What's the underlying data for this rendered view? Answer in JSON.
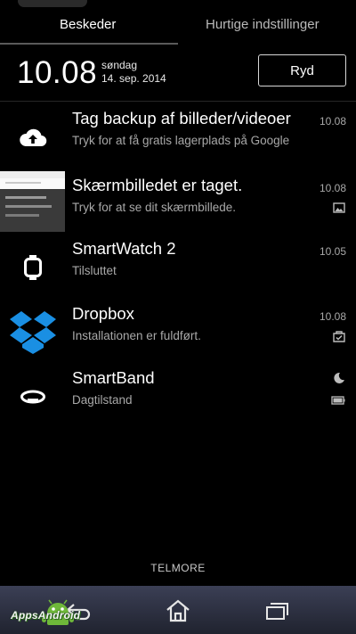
{
  "tabs": {
    "messages": "Beskeder",
    "quick_settings": "Hurtige indstillinger"
  },
  "header": {
    "time": "10.08",
    "day": "søndag",
    "date": "14. sep. 2014",
    "clear_label": "Ryd"
  },
  "notifications": [
    {
      "title": "Tag backup af billeder/videoer",
      "subtitle": "Tryk for at få gratis lagerplads på Google",
      "time": "10.08",
      "icon": "cloud-upload-icon"
    },
    {
      "title": "Skærmbilledet er taget.",
      "subtitle": "Tryk for at se dit skærmbillede.",
      "time": "10.08",
      "icon": "screenshot-thumbnail"
    },
    {
      "title": "SmartWatch 2",
      "subtitle": "Tilsluttet",
      "time": "10.05",
      "icon": "smartwatch-icon"
    },
    {
      "title": "Dropbox",
      "subtitle": "Installationen er fuldført.",
      "time": "10.08",
      "icon": "dropbox-icon"
    },
    {
      "title": "SmartBand",
      "subtitle": "Dagtilstand",
      "time": "",
      "icon": "smartband-icon"
    }
  ],
  "carrier": "TELMORE",
  "watermark": "AppsAndroid"
}
